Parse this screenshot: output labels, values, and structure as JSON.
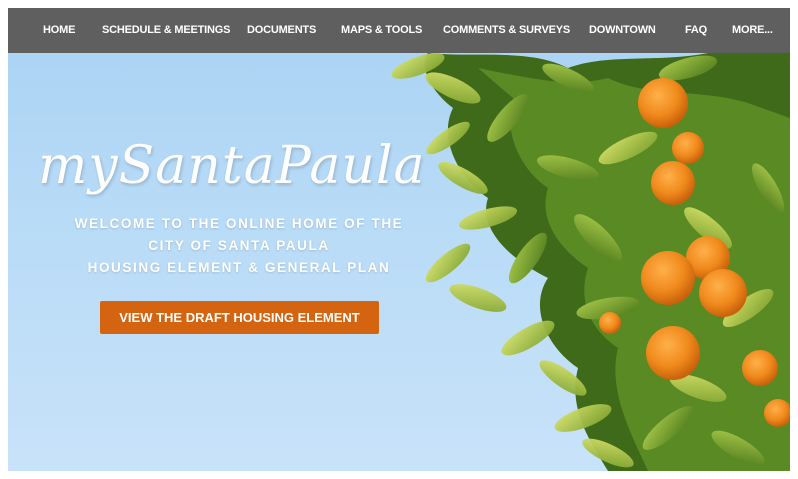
{
  "nav": {
    "items": [
      {
        "label": "HOME"
      },
      {
        "label": "SCHEDULE & MEETINGS"
      },
      {
        "label": "DOCUMENTS"
      },
      {
        "label": "MAPS & TOOLS"
      },
      {
        "label": "COMMENTS & SURVEYS"
      },
      {
        "label": "DOWNTOWN"
      },
      {
        "label": "FAQ"
      },
      {
        "label": "MORE..."
      }
    ]
  },
  "hero": {
    "title": "mySantaPaula",
    "welcome_lines": [
      "WELCOME TO THE ONLINE HOME OF THE",
      "CITY OF SANTA PAULA",
      "HOUSING ELEMENT & GENERAL PLAN"
    ],
    "cta_label": "VIEW THE DRAFT HOUSING ELEMENT"
  },
  "colors": {
    "nav_bg": "#5f5f5f",
    "sky": "#b8dbf7",
    "cta": "#d4640f",
    "orange_fruit": "#f08a1c",
    "leaf": "#6f9a2a"
  }
}
